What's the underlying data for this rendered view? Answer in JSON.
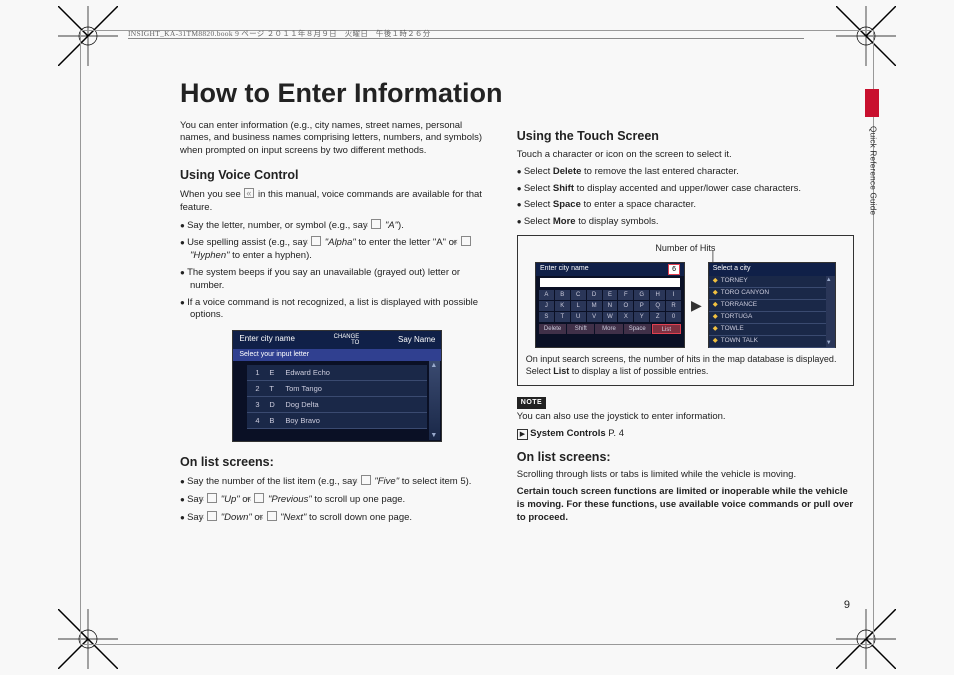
{
  "header_meta": "INSIGHT_KA-31TM8820.book  9 ページ  ２０１１年８月９日　火曜日　午後１時２６分",
  "side_label": "Quick Reference Guide",
  "page_number": "9",
  "title": "How to Enter Information",
  "intro": "You can enter information (e.g., city names, street names, personal names, and business names comprising letters, numbers, and symbols) when prompted on input screens by two different methods.",
  "voice": {
    "heading": "Using Voice Control",
    "lead": "When you see __ICON__ in this manual, voice commands are available for that feature.",
    "b1_pre": "Say the letter, number, or symbol (e.g., say ",
    "b1_q": "\"A\"",
    "b1_post": ").",
    "b2_pre": "Use spelling assist (e.g., say ",
    "b2_q1": "\"Alpha\"",
    "b2_mid": " to enter the letter \"A\" or ",
    "b2_q2": "\"Hyphen\"",
    "b2_post": " to enter a hyphen).",
    "b3": "The system beeps if you say an unavailable (grayed out) letter or number.",
    "b4": "If a voice command is not recognized, a list is displayed with possible options."
  },
  "ss1": {
    "title": "Enter city name",
    "top_r1": "CHANGE",
    "top_r2": "TO",
    "top_r3": "Say  Name",
    "subtitle": "Select your input letter",
    "rows": [
      {
        "n": "1",
        "l": "E",
        "t": "Edward Echo"
      },
      {
        "n": "2",
        "l": "T",
        "t": "Tom Tango"
      },
      {
        "n": "3",
        "l": "D",
        "t": "Dog Delta"
      },
      {
        "n": "4",
        "l": "B",
        "t": "Boy Bravo"
      }
    ]
  },
  "list1": {
    "heading": "On list screens:",
    "b1_pre": "Say the number of the list item (e.g., say ",
    "b1_q": "\"Five\"",
    "b1_post": " to select item 5).",
    "b2_pre": "Say ",
    "b2_q1": "\"Up\"",
    "b2_mid": " or ",
    "b2_q2": "\"Previous\"",
    "b2_post": " to scroll up one page.",
    "b3_pre": "Say ",
    "b3_q1": "\"Down\"",
    "b3_mid": " or ",
    "b3_q2": "\"Next\"",
    "b3_post": " to scroll down one page."
  },
  "touch": {
    "heading": "Using the Touch Screen",
    "lead": "Touch a character or icon on the screen to select it.",
    "b1_pre": "Select ",
    "b1_bold": "Delete",
    "b1_post": " to remove the last entered character.",
    "b2_pre": "Select ",
    "b2_bold": "Shift",
    "b2_post": " to display accented and upper/lower case characters.",
    "b3_pre": "Select ",
    "b3_bold": "Space",
    "b3_post": " to enter a space character.",
    "b4_pre": "Select ",
    "b4_bold": "More",
    "b4_post": " to display symbols."
  },
  "ssbox": {
    "label": "Number of Hits",
    "kbd_title": "Enter city name",
    "kbd_count": "6",
    "keys": [
      "A",
      "B",
      "C",
      "D",
      "E",
      "F",
      "G",
      "H",
      "I",
      "J",
      "K",
      "L",
      "M",
      "N",
      "O",
      "P",
      "Q",
      "R",
      "S",
      "T",
      "U",
      "V",
      "W",
      "X",
      "Y",
      "Z",
      "0"
    ],
    "bot": [
      "Delete",
      "Shift",
      "More",
      "Space",
      "List"
    ],
    "lst_title": "Select a city",
    "lst": [
      "TORNEY",
      "TORO CANYON",
      "TORRANCE",
      "TORTUGA",
      "TOWLE",
      "TOWN TALK"
    ],
    "caption_pre": "On input search screens, the number of hits in the map database is displayed. Select ",
    "caption_bold": "List",
    "caption_post": " to display a list of possible entries."
  },
  "note": {
    "badge": "NOTE",
    "text": "You can also use the joystick to enter information.",
    "ref": "System Controls",
    "ref_page": "P. 4"
  },
  "list2": {
    "heading": "On list screens:",
    "p1": "Scrolling through lists or tabs is limited while the vehicle is moving.",
    "p2": "Certain touch screen functions are limited or inoperable while the vehicle is moving. For these functions, use available voice commands or pull over to proceed."
  }
}
